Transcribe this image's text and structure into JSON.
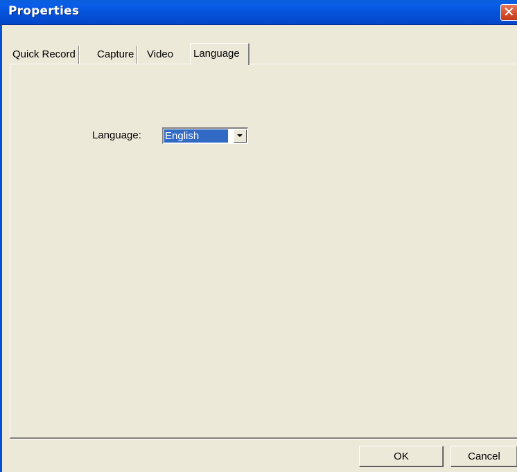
{
  "window": {
    "title": "Properties",
    "close_glyph": "✕"
  },
  "tabs": [
    {
      "label": "Quick Record",
      "active": false
    },
    {
      "label": "Capture",
      "active": false
    },
    {
      "label": "Video",
      "active": false
    },
    {
      "label": "Language",
      "active": true
    }
  ],
  "language_panel": {
    "label": "Language:",
    "selected_value": "English"
  },
  "buttons": {
    "ok": "OK",
    "cancel": "Cancel"
  },
  "colors": {
    "titlebar": "#0450d6",
    "window_bg": "#ece9d8",
    "selection": "#316ac5",
    "close_button": "#d9502e"
  },
  "icons": {
    "close": "close-icon",
    "dropdown": "chevron-down-icon"
  }
}
